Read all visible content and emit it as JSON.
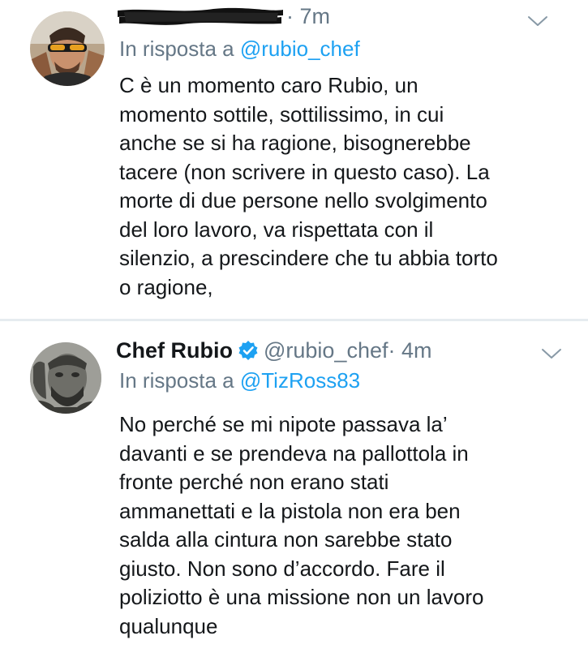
{
  "tweets": [
    {
      "time": "· 7m",
      "reply_prefix": "In risposta a",
      "reply_handle": "@rubio_chef",
      "lines": [
        "C è un momento caro Rubio, un",
        "momento sottile, sottilissimo, in cui",
        "anche se si ha ragione, bisognerebbe",
        "tacere (non scrivere in questo caso). La",
        "morte di due persone nello svolgimento",
        "del loro lavoro,  va rispettata con il",
        "silenzio, a prescindere che tu abbia torto",
        "o ragione,"
      ]
    },
    {
      "name": "Chef Rubio",
      "handle": "@rubio_chef",
      "time": "· 4m",
      "reply_prefix": "In risposta a",
      "reply_handle": "@TizRoss83",
      "lines": [
        "No perché se mi nipote passava la’",
        "davanti e se prendeva na pallottola in",
        "fronte perché non erano stati",
        "ammanettati e la pistola non era ben",
        "salda alla cintura non sarebbe stato",
        "giusto. Non sono d’accordo. Fare il",
        "poliziotto è una missione non un lavoro",
        "qualunque"
      ]
    }
  ],
  "icons": {
    "verified": "verified-badge-icon",
    "menu": "chevron-down-icon"
  },
  "colors": {
    "text": "#14171a",
    "secondary": "#657786",
    "link": "#1da1f2",
    "divider": "#e6ecf0"
  }
}
